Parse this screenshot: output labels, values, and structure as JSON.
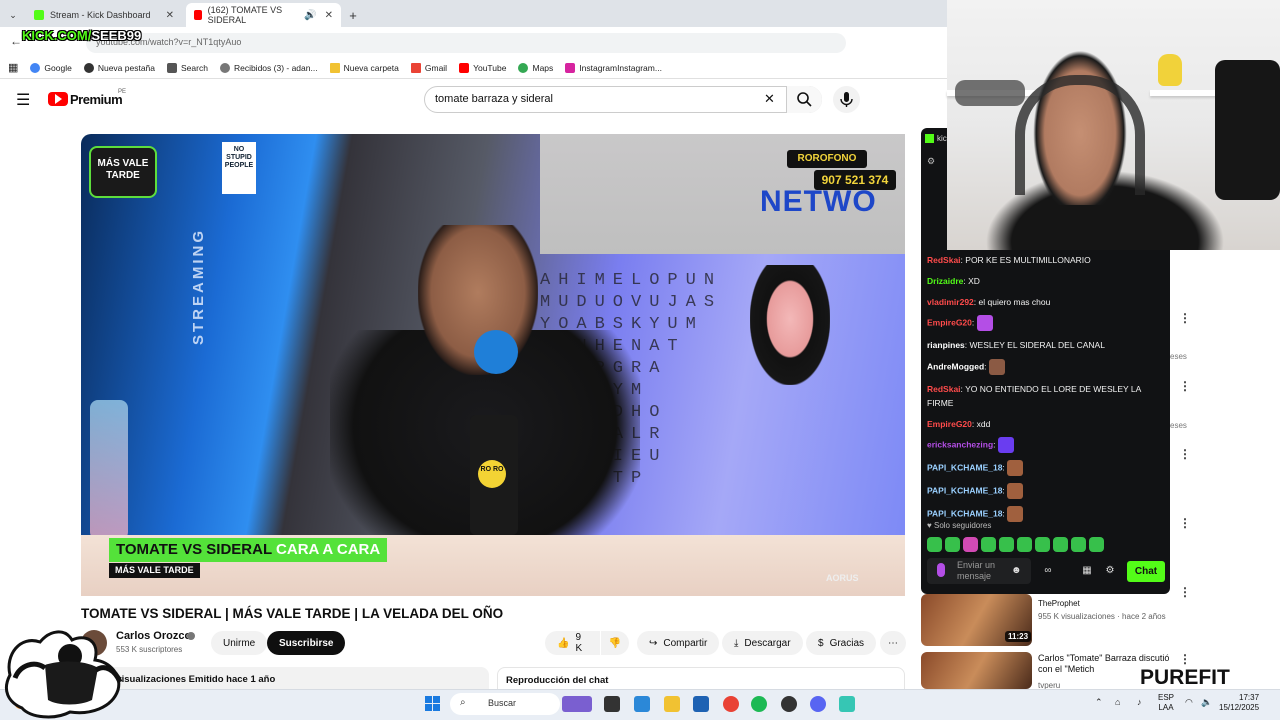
{
  "browser": {
    "tabs": [
      {
        "label": "Stream - Kick Dashboard",
        "color": "#53fc18"
      },
      {
        "label": "(162) TOMATE VS SIDERAL",
        "color": "#ff0000"
      }
    ],
    "url": "youtube.com/watch?v=r_NT1qtyAuo",
    "bookmarks": [
      "Google",
      "Nueva pestaña",
      "Search",
      "Recibidos (3) - adan...",
      "Nueva carpeta",
      "Gmail",
      "YouTube",
      "Maps",
      "InstagramInstagram..."
    ]
  },
  "overlay": {
    "kick_brand": "KICK.COM/",
    "kick_channel": "SEEB99",
    "purefit": "PUREFIT"
  },
  "youtube": {
    "logo": "Premium",
    "logo_region": "PE",
    "search_value": "tomate barraza y sideral",
    "video": {
      "brand": "MÁS VALE TARDE",
      "sign": "NO STUPID PEOPLE",
      "streaming": "STREAMING",
      "rorofono": "ROROFONO",
      "phone": "907 521 374",
      "network": "NETWO",
      "wordsearch": [
        "AHIMELOPUN",
        "MUDUOVUJAS",
        "YOABSKYUM",
        "LDNHENAT",
        "ADEPGRA",
        "ASUHYM",
        "SPEBDHO",
        "FBVSALR",
        "NTOKIEU",
        "ESNGTP"
      ],
      "mic_brand": "RO RO",
      "lower_third_green": "TOMATE VS SIDERAL",
      "lower_third_white": "CARA A CARA",
      "lower_third_show": "MÁS VALE TARDE",
      "watermark": "AORUS"
    },
    "title": "TOMATE VS SIDERAL | MÁS VALE TARDE | LA VELADA DEL OÑO",
    "channel": "Carlos Orozco",
    "subscribers": "553 K suscriptores",
    "join": "Unirme",
    "subscribe": "Suscribirse",
    "likes": "9 K",
    "share": "Compartir",
    "download": "Descargar",
    "thanks": "Gracias",
    "description": "1,5 K visualizaciones   Emitido hace 1 año",
    "chat_replay": "Reproducción del chat"
  },
  "kick_chat": {
    "messages": [
      {
        "user": "RedSkai",
        "color": "#ff4b4b",
        "text": "POR KE ES MULTIMILLONARIO",
        "emote": null
      },
      {
        "user": "Drizaidre",
        "color": "#53fc18",
        "text": "XD",
        "emote": null
      },
      {
        "user": "vladimir292",
        "color": "#ff4b4b",
        "text": "el quiero mas chou",
        "emote": null
      },
      {
        "user": "EmpireG20",
        "color": "#ff4b4b",
        "text": "",
        "emote": "#b44ee6"
      },
      {
        "user": "rianpines",
        "color": "#ffffff",
        "text": "WESLEY EL SIDERAL DEL CANAL",
        "emote": null
      },
      {
        "user": "AndreMogged",
        "color": "#ffffff",
        "text": "",
        "emote": "#8b5a44"
      },
      {
        "user": "RedSkai",
        "color": "#ff4b4b",
        "text": "YO NO ENTIENDO EL LORE DE WESLEY LA FIRME",
        "emote": null
      },
      {
        "user": "EmpireG20",
        "color": "#ff4b4b",
        "text": "xdd",
        "emote": null
      },
      {
        "user": "ericksanchezing",
        "color": "#b44ee6",
        "text": "",
        "emote": "#6a3df0"
      },
      {
        "user": "PAPI_KCHAME_18",
        "color": "#9ad0ff",
        "text": "",
        "emote": "#a0603e"
      },
      {
        "user": "PAPI_KCHAME_18",
        "color": "#9ad0ff",
        "text": "",
        "emote": "#a0603e"
      },
      {
        "user": "PAPI_KCHAME_18",
        "color": "#9ad0ff",
        "text": "",
        "emote": "#a0603e"
      }
    ],
    "followers_only": "Solo seguidores",
    "input_placeholder": "Enviar un mensaje",
    "chat_button": "Chat",
    "header_label": "kic"
  },
  "sidebar": {
    "recos": [
      {
        "title": "",
        "channel": "TheProphet",
        "meta": "955 K visualizaciones · hace 2 años",
        "duration": "11:23"
      },
      {
        "title": "Carlos \"Tomate\" Barraza discutió con el \"Metich",
        "channel": "tvperu",
        "meta": "",
        "duration": ""
      }
    ],
    "peek": [
      "eses",
      "eses"
    ]
  },
  "taskbar": {
    "search": "Buscar",
    "lang_top": "ESP",
    "lang_bottom": "LAA",
    "time": "17:37",
    "date": "15/12/2025"
  }
}
